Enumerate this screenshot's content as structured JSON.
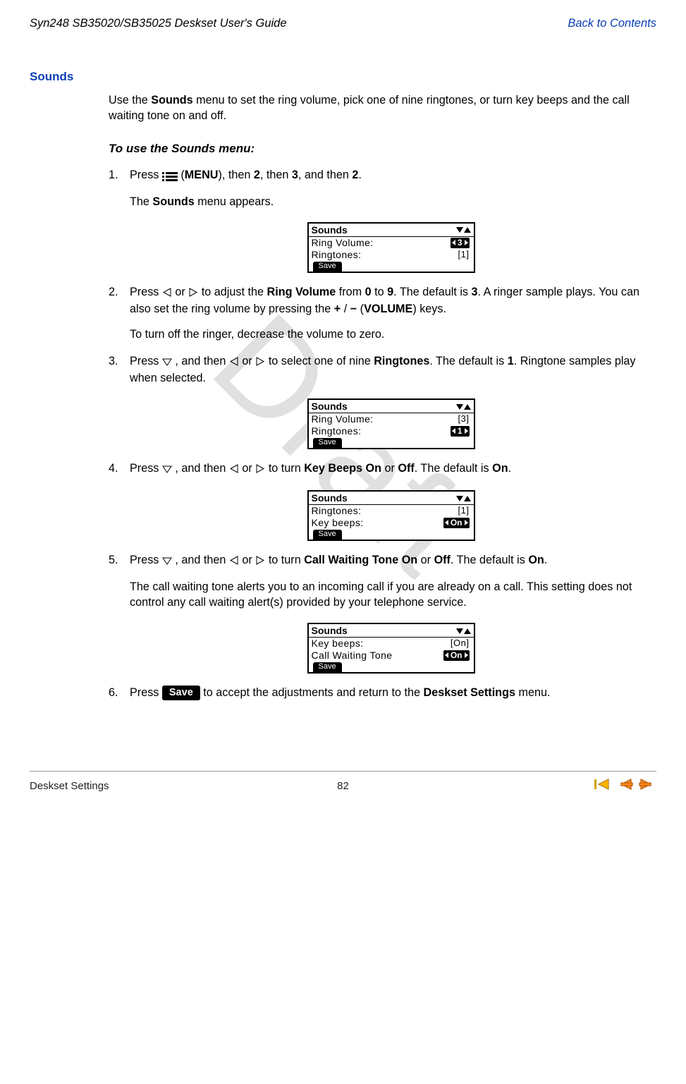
{
  "header": {
    "doc_title": "Syn248 SB35020/SB35025 Deskset User's Guide",
    "back_link": "Back to Contents"
  },
  "section": {
    "title": "Sounds",
    "intro_1": "Use the ",
    "intro_bold_1": "Sounds",
    "intro_2": " menu to set the ring volume, pick one of nine ringtones, or turn key beeps and the call waiting tone on and off.",
    "sub_title": "To use the Sounds menu:"
  },
  "steps": {
    "s1_a": "Press ",
    "s1_menu": "MENU",
    "s1_b": "), then ",
    "s1_k2": "2",
    "s1_c": ", then ",
    "s1_k3": "3",
    "s1_d": ", and then ",
    "s1_k2b": "2",
    "s1_e": ".",
    "s1_sub_a": "The ",
    "s1_sub_bold": "Sounds",
    "s1_sub_b": " menu appears.",
    "s2_a": "Press ",
    "s2_b": " or ",
    "s2_c": " to adjust the ",
    "s2_bold1": "Ring Volume",
    "s2_d": " from ",
    "s2_bold2": "0",
    "s2_e": " to ",
    "s2_bold3": "9",
    "s2_f": ". The default is ",
    "s2_bold4": "3",
    "s2_g": ". A ringer sample plays. You can also set the ring volume by pressing the ",
    "s2_bold5": "+",
    "s2_h": " / ",
    "s2_bold6": "−",
    "s2_i": " (",
    "s2_bold7": "VOLUME",
    "s2_j": ") keys.",
    "s2_sub": "To turn off the ringer, decrease the volume to zero.",
    "s3_a": "Press ",
    "s3_b": ", and then ",
    "s3_c": " or ",
    "s3_d": " to select one of nine ",
    "s3_bold1": "Ringtones",
    "s3_e": ". The default is ",
    "s3_bold2": "1",
    "s3_f": ". Ringtone samples play when selected.",
    "s4_a": "Press ",
    "s4_b": ", and then ",
    "s4_c": " or ",
    "s4_d": " to turn ",
    "s4_bold1": "Key Beeps On",
    "s4_e": " or ",
    "s4_bold2": "Off",
    "s4_f": ". The default is ",
    "s4_bold3": "On",
    "s4_g": ".",
    "s5_a": "Press ",
    "s5_b": ", and then ",
    "s5_c": " or ",
    "s5_d": " to turn ",
    "s5_bold1": "Call Waiting Tone On",
    "s5_e": " or ",
    "s5_bold2": "Off",
    "s5_f": ". The default is ",
    "s5_bold3": "On",
    "s5_g": ".",
    "s5_sub": "The call waiting tone alerts you to an incoming call if you are already on a call. This setting does not control any call waiting alert(s) provided by your telephone service.",
    "s6_a": "Press ",
    "s6_btn": "Save",
    "s6_b": " to accept the adjustments and return to the ",
    "s6_bold1": "Deskset Settings",
    "s6_c": " menu."
  },
  "lcd": {
    "title": "Sounds",
    "save": "Save",
    "ring_volume_label": "Ring  Volume:",
    "ringtones_label": "Ringtones:",
    "key_beeps_label": "Key  beeps:",
    "call_waiting_label": "Call  Waiting  Tone",
    "val_3": "3",
    "val_1": "1",
    "val_on": "On",
    "plain_3": "[3]",
    "plain_1": "[1]",
    "plain_on": "[On]"
  },
  "watermark": "Draft",
  "footer": {
    "section": "Deskset Settings",
    "page": "82"
  }
}
